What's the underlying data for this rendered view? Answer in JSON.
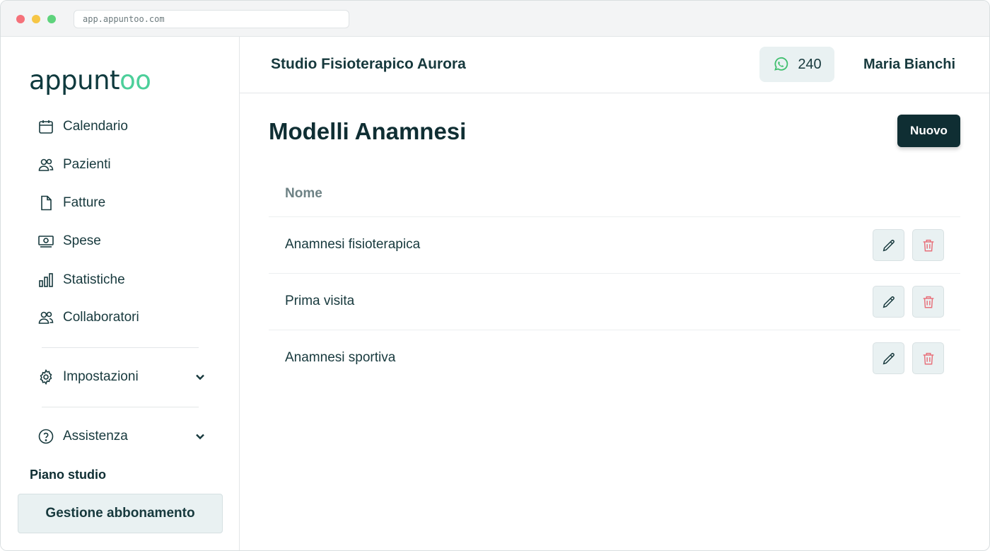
{
  "browser": {
    "url": "app.appuntoo.com"
  },
  "logo": {
    "prefix": "appunt",
    "suffix": "oo"
  },
  "sidebar": {
    "items": [
      {
        "label": "Calendario",
        "icon": "calendar-icon"
      },
      {
        "label": "Pazienti",
        "icon": "users-icon"
      },
      {
        "label": "Fatture",
        "icon": "document-icon"
      },
      {
        "label": "Spese",
        "icon": "cash-icon"
      },
      {
        "label": "Statistiche",
        "icon": "bar-chart-icon"
      },
      {
        "label": "Collaboratori",
        "icon": "users-icon"
      }
    ],
    "settings": {
      "label": "Impostazioni",
      "icon": "gear-icon"
    },
    "help": {
      "label": "Assistenza",
      "icon": "question-circle-icon"
    },
    "plan_label": "Piano studio",
    "plan_button": "Gestione abbonamento"
  },
  "header": {
    "studio_name": "Studio Fisioterapico Aurora",
    "whatsapp_count": "240",
    "user_name": "Maria Bianchi"
  },
  "main": {
    "title": "Modelli Anamnesi",
    "new_button": "Nuovo",
    "table": {
      "columns": [
        "Nome"
      ],
      "rows": [
        {
          "name": "Anamnesi fisioterapica"
        },
        {
          "name": "Prima visita"
        },
        {
          "name": "Anamnesi sportiva"
        }
      ]
    }
  },
  "colors": {
    "primary": "#0f2e33",
    "accent": "#4ccf9a",
    "button_bg": "#e9f1f2",
    "delete_icon": "#e8707a"
  }
}
